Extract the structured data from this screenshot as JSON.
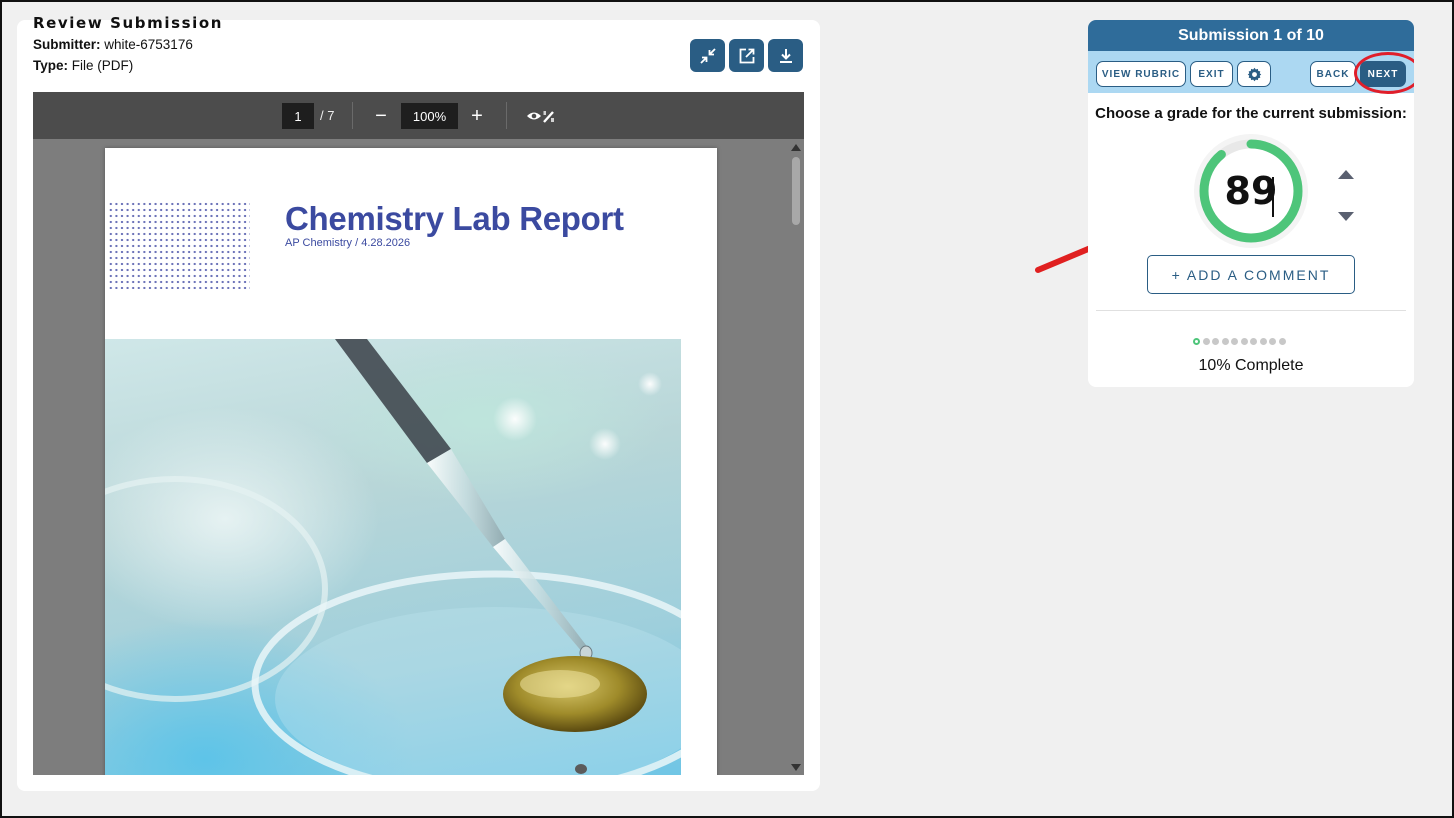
{
  "review": {
    "title": "Review Submission",
    "submitter_label": "Submitter:",
    "submitter_value": "white-6753176",
    "type_label": "Type:",
    "type_value": "File (PDF)",
    "toolbar_icons": [
      "collapse-icon",
      "open-external-icon",
      "download-icon"
    ]
  },
  "viewer": {
    "current_page": "1",
    "total_pages": "/ 7",
    "zoom_out": "−",
    "zoom": "100%",
    "zoom_in": "+",
    "toggle_icon": "eye-pen-icon"
  },
  "document": {
    "title": "Chemistry Lab Report",
    "subtitle": "AP Chemistry  /  4.28.2026",
    "accent_color": "#3b4aa0"
  },
  "grading": {
    "header": "Submission 1 of 10",
    "buttons": {
      "view_rubric": "VIEW RUBRIC",
      "exit": "EXIT",
      "settings_icon": "gear-icon",
      "back": "BACK",
      "next": "NEXT"
    },
    "prompt": "Choose a grade for the current submission:",
    "grade": "89",
    "grade_fraction": 0.89,
    "add_comment": "+ ADD A COMMENT",
    "progress_total": 10,
    "progress_done": 1,
    "progress_text": "10% Complete",
    "accent_color": "#2f6c9a",
    "ring_color": "#4ec57a"
  }
}
